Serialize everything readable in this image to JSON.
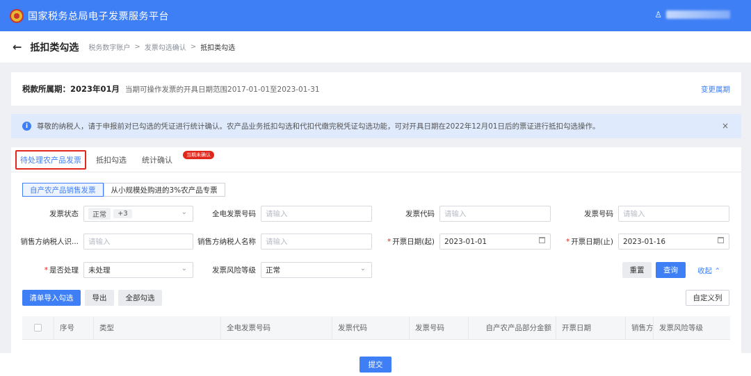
{
  "app": {
    "title": "国家税务总局电子发票服务平台"
  },
  "header": {
    "page_title": "抵扣类勾选",
    "back_icon": "arrow-left-icon"
  },
  "breadcrumb": {
    "items": [
      "税务数字账户",
      "发票勾选确认",
      "抵扣类勾选"
    ],
    "sep": ">"
  },
  "period": {
    "label": "税款所属期：",
    "value": "2023年01月",
    "range": "当期可操作发票的开具日期范围2017-01-01至2023-01-31",
    "change_link": "变更属期"
  },
  "notice": {
    "icon": "i",
    "text": "尊敬的纳税人，请于申报前对已勾选的凭证进行统计确认。农产品业务抵扣勾选和代扣代缴完税凭证勾选功能，可对开具日期在2022年12月01日后的票证进行抵扣勾选操作。",
    "close": "×"
  },
  "tabs": [
    {
      "label": "待处理农产品发票"
    },
    {
      "label": "抵扣勾选"
    },
    {
      "label": "统计确认",
      "badge": "当期未确认"
    }
  ],
  "subtabs": [
    {
      "label": "自产农产品销售发票"
    },
    {
      "label": "从小规模处购进的3%农产品专票"
    }
  ],
  "form": {
    "invoice_status": {
      "label": "发票状态",
      "chip1": "正常",
      "chip2": "+3"
    },
    "full_invoice_no": {
      "label": "全电发票号码",
      "placeholder": "请输入"
    },
    "invoice_code": {
      "label": "发票代码",
      "placeholder": "请输入"
    },
    "invoice_no": {
      "label": "发票号码",
      "placeholder": "请输入"
    },
    "seller_tax_id": {
      "label": "销售方纳税人识...",
      "placeholder": "请输入"
    },
    "seller_name": {
      "label": "销售方纳税人名称",
      "placeholder": "请输入"
    },
    "date_start": {
      "label": "开票日期(起)",
      "required": "*",
      "value": "2023-01-01"
    },
    "date_end": {
      "label": "开票日期(止)",
      "required": "*",
      "value": "2023-01-16"
    },
    "processed": {
      "label": "是否处理",
      "required": "*",
      "value": "未处理"
    },
    "risk_level": {
      "label": "发票风险等级",
      "value": "正常"
    }
  },
  "actions": {
    "reset": "重置",
    "query": "查询",
    "collapse": "收起",
    "import_select": "清单导入勾选",
    "export": "导出",
    "select_all": "全部勾选",
    "custom_columns": "自定义列"
  },
  "table": {
    "columns": [
      "序号",
      "类型",
      "全电发票号码",
      "发票代码",
      "发票号码",
      "自产农产品部分金额",
      "开票日期",
      "销售方纳",
      "发票风险等级"
    ]
  },
  "footer": {
    "submit": "提交"
  }
}
